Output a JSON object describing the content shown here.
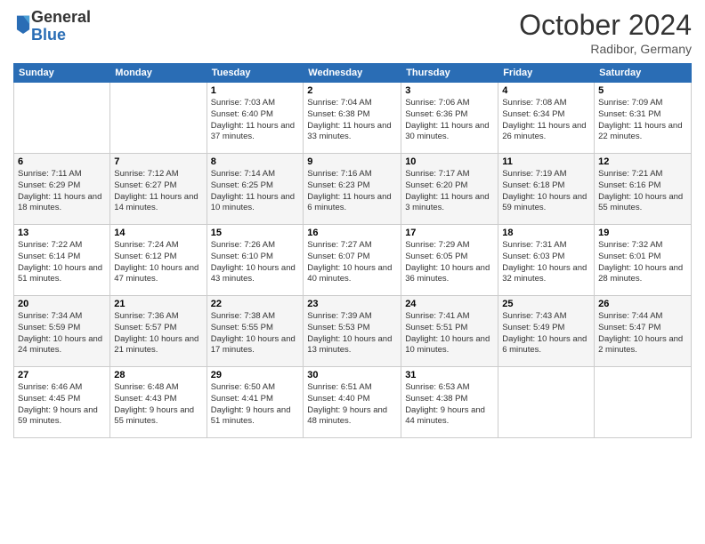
{
  "logo": {
    "general": "General",
    "blue": "Blue"
  },
  "header": {
    "month": "October 2024",
    "location": "Radibor, Germany"
  },
  "weekdays": [
    "Sunday",
    "Monday",
    "Tuesday",
    "Wednesday",
    "Thursday",
    "Friday",
    "Saturday"
  ],
  "weeks": [
    [
      {
        "day": "",
        "sunrise": "",
        "sunset": "",
        "daylight": ""
      },
      {
        "day": "",
        "sunrise": "",
        "sunset": "",
        "daylight": ""
      },
      {
        "day": "1",
        "sunrise": "Sunrise: 7:03 AM",
        "sunset": "Sunset: 6:40 PM",
        "daylight": "Daylight: 11 hours and 37 minutes."
      },
      {
        "day": "2",
        "sunrise": "Sunrise: 7:04 AM",
        "sunset": "Sunset: 6:38 PM",
        "daylight": "Daylight: 11 hours and 33 minutes."
      },
      {
        "day": "3",
        "sunrise": "Sunrise: 7:06 AM",
        "sunset": "Sunset: 6:36 PM",
        "daylight": "Daylight: 11 hours and 30 minutes."
      },
      {
        "day": "4",
        "sunrise": "Sunrise: 7:08 AM",
        "sunset": "Sunset: 6:34 PM",
        "daylight": "Daylight: 11 hours and 26 minutes."
      },
      {
        "day": "5",
        "sunrise": "Sunrise: 7:09 AM",
        "sunset": "Sunset: 6:31 PM",
        "daylight": "Daylight: 11 hours and 22 minutes."
      }
    ],
    [
      {
        "day": "6",
        "sunrise": "Sunrise: 7:11 AM",
        "sunset": "Sunset: 6:29 PM",
        "daylight": "Daylight: 11 hours and 18 minutes."
      },
      {
        "day": "7",
        "sunrise": "Sunrise: 7:12 AM",
        "sunset": "Sunset: 6:27 PM",
        "daylight": "Daylight: 11 hours and 14 minutes."
      },
      {
        "day": "8",
        "sunrise": "Sunrise: 7:14 AM",
        "sunset": "Sunset: 6:25 PM",
        "daylight": "Daylight: 11 hours and 10 minutes."
      },
      {
        "day": "9",
        "sunrise": "Sunrise: 7:16 AM",
        "sunset": "Sunset: 6:23 PM",
        "daylight": "Daylight: 11 hours and 6 minutes."
      },
      {
        "day": "10",
        "sunrise": "Sunrise: 7:17 AM",
        "sunset": "Sunset: 6:20 PM",
        "daylight": "Daylight: 11 hours and 3 minutes."
      },
      {
        "day": "11",
        "sunrise": "Sunrise: 7:19 AM",
        "sunset": "Sunset: 6:18 PM",
        "daylight": "Daylight: 10 hours and 59 minutes."
      },
      {
        "day": "12",
        "sunrise": "Sunrise: 7:21 AM",
        "sunset": "Sunset: 6:16 PM",
        "daylight": "Daylight: 10 hours and 55 minutes."
      }
    ],
    [
      {
        "day": "13",
        "sunrise": "Sunrise: 7:22 AM",
        "sunset": "Sunset: 6:14 PM",
        "daylight": "Daylight: 10 hours and 51 minutes."
      },
      {
        "day": "14",
        "sunrise": "Sunrise: 7:24 AM",
        "sunset": "Sunset: 6:12 PM",
        "daylight": "Daylight: 10 hours and 47 minutes."
      },
      {
        "day": "15",
        "sunrise": "Sunrise: 7:26 AM",
        "sunset": "Sunset: 6:10 PM",
        "daylight": "Daylight: 10 hours and 43 minutes."
      },
      {
        "day": "16",
        "sunrise": "Sunrise: 7:27 AM",
        "sunset": "Sunset: 6:07 PM",
        "daylight": "Daylight: 10 hours and 40 minutes."
      },
      {
        "day": "17",
        "sunrise": "Sunrise: 7:29 AM",
        "sunset": "Sunset: 6:05 PM",
        "daylight": "Daylight: 10 hours and 36 minutes."
      },
      {
        "day": "18",
        "sunrise": "Sunrise: 7:31 AM",
        "sunset": "Sunset: 6:03 PM",
        "daylight": "Daylight: 10 hours and 32 minutes."
      },
      {
        "day": "19",
        "sunrise": "Sunrise: 7:32 AM",
        "sunset": "Sunset: 6:01 PM",
        "daylight": "Daylight: 10 hours and 28 minutes."
      }
    ],
    [
      {
        "day": "20",
        "sunrise": "Sunrise: 7:34 AM",
        "sunset": "Sunset: 5:59 PM",
        "daylight": "Daylight: 10 hours and 24 minutes."
      },
      {
        "day": "21",
        "sunrise": "Sunrise: 7:36 AM",
        "sunset": "Sunset: 5:57 PM",
        "daylight": "Daylight: 10 hours and 21 minutes."
      },
      {
        "day": "22",
        "sunrise": "Sunrise: 7:38 AM",
        "sunset": "Sunset: 5:55 PM",
        "daylight": "Daylight: 10 hours and 17 minutes."
      },
      {
        "day": "23",
        "sunrise": "Sunrise: 7:39 AM",
        "sunset": "Sunset: 5:53 PM",
        "daylight": "Daylight: 10 hours and 13 minutes."
      },
      {
        "day": "24",
        "sunrise": "Sunrise: 7:41 AM",
        "sunset": "Sunset: 5:51 PM",
        "daylight": "Daylight: 10 hours and 10 minutes."
      },
      {
        "day": "25",
        "sunrise": "Sunrise: 7:43 AM",
        "sunset": "Sunset: 5:49 PM",
        "daylight": "Daylight: 10 hours and 6 minutes."
      },
      {
        "day": "26",
        "sunrise": "Sunrise: 7:44 AM",
        "sunset": "Sunset: 5:47 PM",
        "daylight": "Daylight: 10 hours and 2 minutes."
      }
    ],
    [
      {
        "day": "27",
        "sunrise": "Sunrise: 6:46 AM",
        "sunset": "Sunset: 4:45 PM",
        "daylight": "Daylight: 9 hours and 59 minutes."
      },
      {
        "day": "28",
        "sunrise": "Sunrise: 6:48 AM",
        "sunset": "Sunset: 4:43 PM",
        "daylight": "Daylight: 9 hours and 55 minutes."
      },
      {
        "day": "29",
        "sunrise": "Sunrise: 6:50 AM",
        "sunset": "Sunset: 4:41 PM",
        "daylight": "Daylight: 9 hours and 51 minutes."
      },
      {
        "day": "30",
        "sunrise": "Sunrise: 6:51 AM",
        "sunset": "Sunset: 4:40 PM",
        "daylight": "Daylight: 9 hours and 48 minutes."
      },
      {
        "day": "31",
        "sunrise": "Sunrise: 6:53 AM",
        "sunset": "Sunset: 4:38 PM",
        "daylight": "Daylight: 9 hours and 44 minutes."
      },
      {
        "day": "",
        "sunrise": "",
        "sunset": "",
        "daylight": ""
      },
      {
        "day": "",
        "sunrise": "",
        "sunset": "",
        "daylight": ""
      }
    ]
  ]
}
